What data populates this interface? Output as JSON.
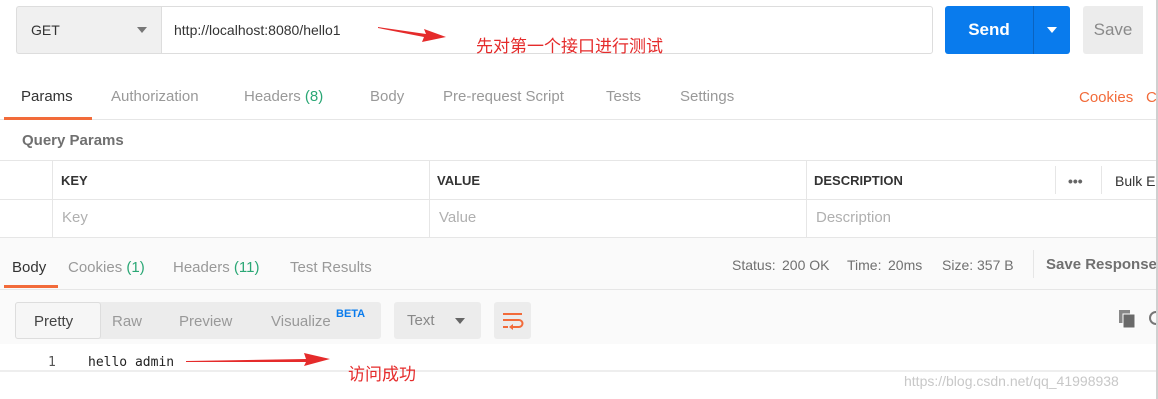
{
  "request": {
    "method": "GET",
    "url": "http://localhost:8080/hello1",
    "send_label": "Send",
    "save_label": "Save",
    "annotation": "先对第一个接口进行测试"
  },
  "request_tabs": {
    "items": [
      {
        "label": "Params"
      },
      {
        "label": "Authorization"
      },
      {
        "label": "Headers"
      },
      {
        "label": "Body"
      },
      {
        "label": "Pre-request Script"
      },
      {
        "label": "Tests"
      },
      {
        "label": "Settings"
      }
    ],
    "headers_count": "(8)",
    "cookies_label": "Cookies",
    "code_label": "Co"
  },
  "query_params": {
    "title": "Query Params",
    "columns": [
      "KEY",
      "VALUE",
      "DESCRIPTION"
    ],
    "more": "•••",
    "bulk_edit": "Bulk E",
    "placeholders": [
      "Key",
      "Value",
      "Description"
    ]
  },
  "response": {
    "tabs": [
      "Body",
      "Cookies",
      "Headers",
      "Test Results"
    ],
    "cookies_count": "(1)",
    "headers_count": "(11)",
    "status_label": "Status:",
    "status_value": "200 OK",
    "time_label": "Time:",
    "time_value": "20ms",
    "size_label": "Size:",
    "size_value": "357 B",
    "save_response": "Save Response",
    "view_modes": [
      "Pretty",
      "Raw",
      "Preview",
      "Visualize"
    ],
    "beta": "BETA",
    "format": "Text",
    "line_number": "1",
    "code": "hello admin",
    "annotation": "访问成功"
  },
  "watermark": "https://blog.csdn.net/qq_41998938",
  "colors": {
    "accent": "#f26b3a",
    "send": "#097bed",
    "success": "#2aa775",
    "annotation": "#e52b2b"
  }
}
